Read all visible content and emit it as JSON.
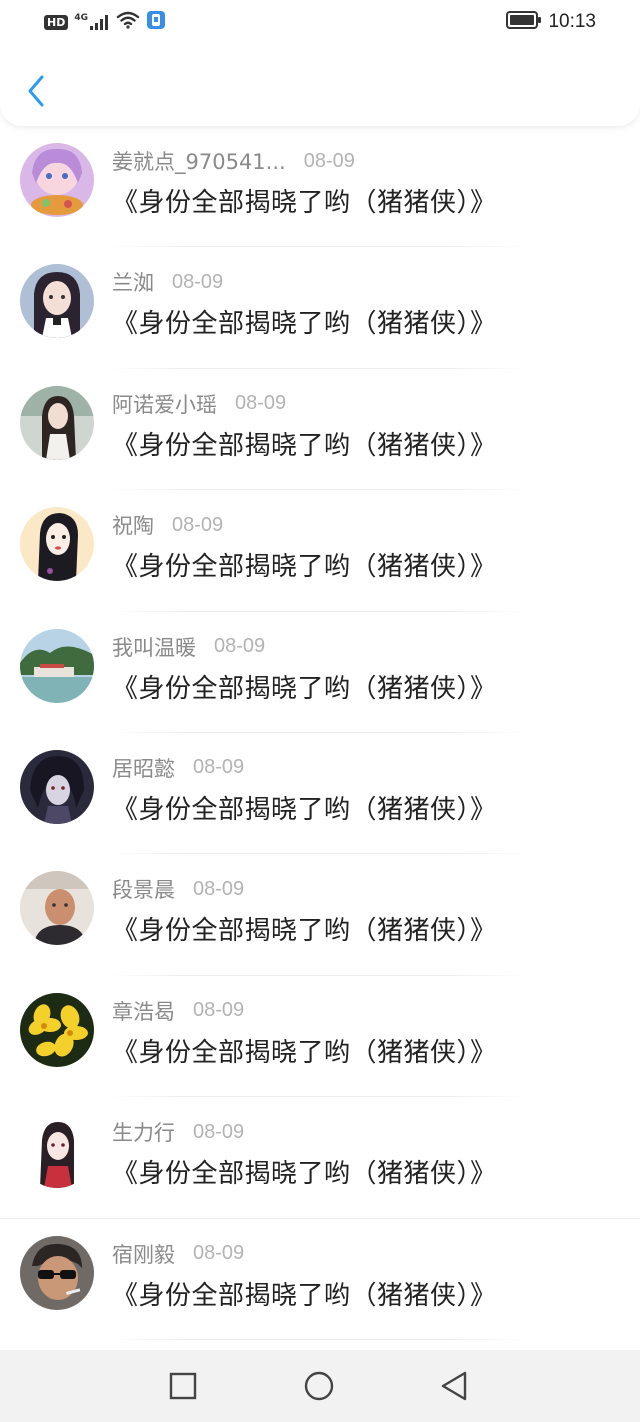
{
  "status_bar": {
    "hd_label": "HD",
    "network_label": "4G",
    "time": "10:13"
  },
  "header": {
    "back_icon": "chevron-left-icon",
    "accent_color": "#2b9cf2"
  },
  "items": [
    {
      "name": "姜就点_970541...",
      "date": "08-09",
      "title": "《身份全部揭晓了哟（猪猪侠）》",
      "avatar": "anime-girl-colorful"
    },
    {
      "name": "兰洳",
      "date": "08-09",
      "title": "《身份全部揭晓了哟（猪猪侠）》",
      "avatar": "anime-girl-dark-hair"
    },
    {
      "name": "阿诺爱小瑶",
      "date": "08-09",
      "title": "《身份全部揭晓了哟（猪猪侠）》",
      "avatar": "photo-girl"
    },
    {
      "name": "祝陶",
      "date": "08-09",
      "title": "《身份全部揭晓了哟（猪猪侠）》",
      "avatar": "illustration-woman"
    },
    {
      "name": "我叫温暖",
      "date": "08-09",
      "title": "《身份全部揭晓了哟（猪猪侠）》",
      "avatar": "landscape-lake"
    },
    {
      "name": "居昭懿",
      "date": "08-09",
      "title": "《身份全部揭晓了哟（猪猪侠）》",
      "avatar": "anime-boy-dark"
    },
    {
      "name": "段景晨",
      "date": "08-09",
      "title": "《身份全部揭晓了哟（猪猪侠）》",
      "avatar": "photo-man"
    },
    {
      "name": "章浩曷",
      "date": "08-09",
      "title": "《身份全部揭晓了哟（猪猪侠）》",
      "avatar": "yellow-flowers"
    },
    {
      "name": "生力行",
      "date": "08-09",
      "title": "《身份全部揭晓了哟（猪猪侠）》",
      "avatar": "anime-girl-red"
    },
    {
      "name": "宿刚毅",
      "date": "08-09",
      "title": "《身份全部揭晓了哟（猪猪侠）》",
      "avatar": "man-sunglasses"
    }
  ],
  "navigation": {
    "recents_icon": "square-icon",
    "home_icon": "circle-icon",
    "back_icon": "triangle-back-icon"
  }
}
